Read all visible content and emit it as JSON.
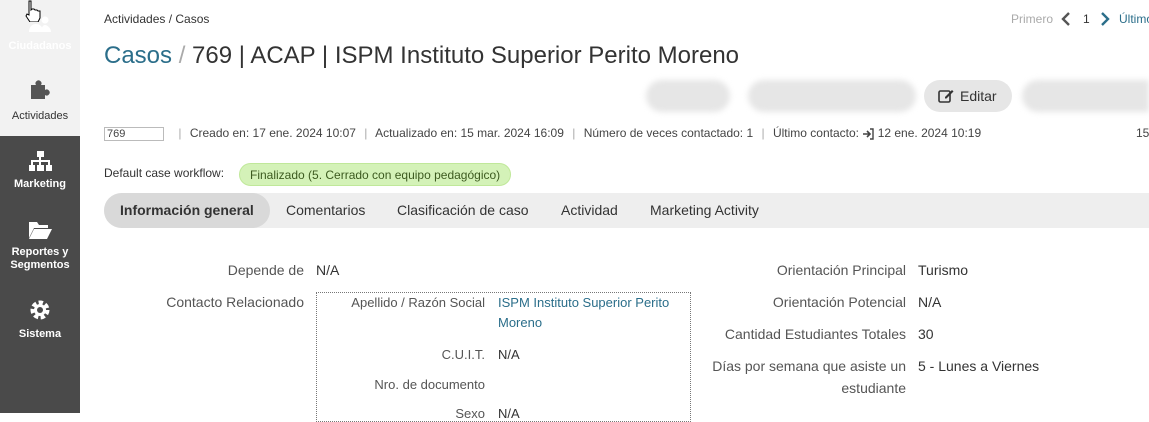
{
  "sidebar": {
    "items": [
      {
        "label": "Ciudadanos",
        "icon": "users-icon"
      },
      {
        "label": "Actividades",
        "icon": "puzzle-icon"
      },
      {
        "label": "Marketing",
        "icon": "sitemap-icon"
      },
      {
        "label": "Reportes y Segmentos",
        "icon": "folder-open-icon"
      },
      {
        "label": "Sistema",
        "icon": "gear-icon"
      }
    ]
  },
  "breadcrumb": "Actividades / Casos",
  "pager": {
    "first": "Primero",
    "current": "1",
    "last": "Último"
  },
  "title": {
    "section": "Casos",
    "separator": "/",
    "record": "769 | ACAP | ISPM Instituto Superior Perito Moreno"
  },
  "actions": {
    "edit_label": "Editar"
  },
  "meta": {
    "number": "769",
    "created": "Creado en: 17 ene. 2024 10:07",
    "updated": "Actualizado en: 15 mar. 2024 16:09",
    "contacted": "Número de veces contactado: 1",
    "last_contact_label": "Último contacto:",
    "last_contact_value": "12 ene. 2024 10:19",
    "right_cut": "15"
  },
  "workflow": {
    "label": "Default case workflow:",
    "status": "Finalizado (5. Cerrado con equipo pedagógico)"
  },
  "tabs": [
    "Información general",
    "Comentarios",
    "Clasificación de caso",
    "Actividad",
    "Marketing Activity"
  ],
  "details_left": {
    "depende_label": "Depende de",
    "depende_value": "N/A",
    "contacto_label": "Contacto Relacionado",
    "related": {
      "apellido_label": "Apellido / Razón Social",
      "apellido_value": "ISPM Instituto Superior Perito Moreno",
      "cuit_label": "C.U.I.T.",
      "cuit_value": "N/A",
      "doc_label": "Nro. de documento",
      "doc_value": "",
      "sexo_label": "Sexo",
      "sexo_value": "N/A"
    }
  },
  "details_right": {
    "orient_principal_label": "Orientación Principal",
    "orient_principal_value": "Turismo",
    "orient_potencial_label": "Orientación Potencial",
    "orient_potencial_value": "N/A",
    "estudiantes_label": "Cantidad Estudiantes Totales",
    "estudiantes_value": "30",
    "dias_label_1": "Días por semana que asiste un",
    "dias_label_2": "estudiante",
    "dias_value": "5 - Lunes a Viernes"
  },
  "colors": {
    "sidebar": "#4a4a4a",
    "link": "#2b6e8a",
    "badge": "#d4f2b8"
  }
}
